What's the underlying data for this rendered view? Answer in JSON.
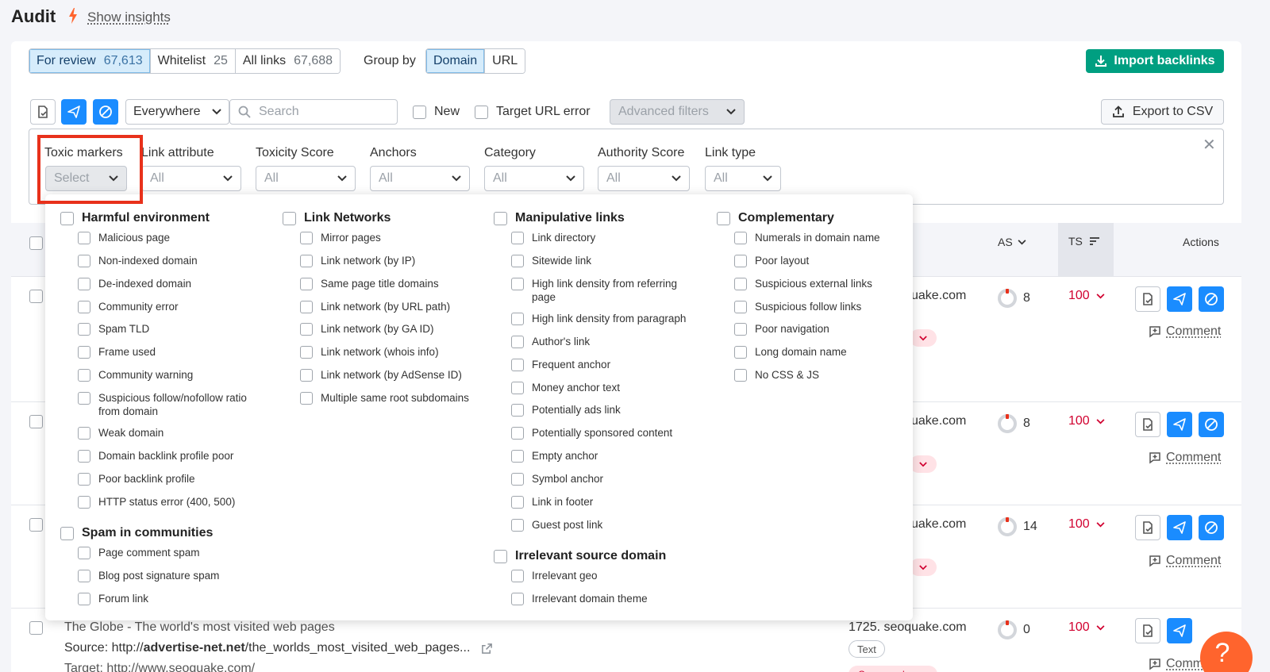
{
  "header": {
    "title": "Audit",
    "insights_label": "Show insights"
  },
  "tabs": [
    {
      "label": "For review",
      "count": "67,613",
      "active": true
    },
    {
      "label": "Whitelist",
      "count": "25",
      "active": false
    },
    {
      "label": "All links",
      "count": "67,688",
      "active": false
    }
  ],
  "group_by": {
    "label": "Group by",
    "options": [
      "Domain",
      "URL"
    ],
    "selected": "Domain"
  },
  "import_button": "Import backlinks",
  "toolbar": {
    "scope_dropdown": "Everywhere",
    "search_placeholder": "Search",
    "new_label": "New",
    "target_url_error_label": "Target URL error",
    "advanced_filters": "Advanced filters",
    "export": "Export to CSV"
  },
  "filters": [
    {
      "label": "Toxic markers",
      "value": "Select"
    },
    {
      "label": "Link attribute",
      "value": "All"
    },
    {
      "label": "Toxicity Score",
      "value": "All"
    },
    {
      "label": "Anchors",
      "value": "All"
    },
    {
      "label": "Category",
      "value": "All"
    },
    {
      "label": "Authority Score",
      "value": "All"
    },
    {
      "label": "Link type",
      "value": "All"
    }
  ],
  "table_header": {
    "as": "AS",
    "ts": "TS",
    "actions": "Actions"
  },
  "rows": [
    {
      "domain": "uake.com",
      "as": "8",
      "ts": "100",
      "comment": "Comment"
    },
    {
      "domain": "uake.com",
      "as": "8",
      "ts": "100",
      "comment": "Comment"
    },
    {
      "domain": "uake.com",
      "as": "14",
      "ts": "100",
      "comment": "Comment"
    }
  ],
  "bottom_row": {
    "title": "The Globe - The world's most visited web pages",
    "source_label": "Source: ",
    "source_prefix": "http://",
    "source_domain": "advertise-net.net",
    "source_path": "/the_worlds_most_visited_web_pages...",
    "target": "Target: http://www.seoquake.com/",
    "domain": "1725. seoquake.com",
    "link_type": "Text",
    "compound": "Compound",
    "as": "0",
    "ts": "100",
    "comment": "Comm"
  },
  "toxic_markers": {
    "harmful": {
      "title": "Harmful environment",
      "items": [
        "Malicious page",
        "Non-indexed domain",
        "De-indexed domain",
        "Community error",
        "Spam TLD",
        "Frame used",
        "Community warning",
        "Suspicious follow/nofollow ratio from domain",
        "Weak domain",
        "Domain backlink profile poor",
        "Poor backlink profile",
        "HTTP status error (400, 500)"
      ]
    },
    "spam": {
      "title": "Spam in communities",
      "items": [
        "Page comment spam",
        "Blog post signature spam",
        "Forum link"
      ]
    },
    "networks": {
      "title": "Link Networks",
      "items": [
        "Mirror pages",
        "Link network (by IP)",
        "Same page title domains",
        "Link network (by URL path)",
        "Link network (by GA ID)",
        "Link network (whois info)",
        "Link network (by AdSense ID)",
        "Multiple same root subdomains"
      ]
    },
    "manipulative": {
      "title": "Manipulative links",
      "items": [
        "Link directory",
        "Sitewide link",
        "High link density from referring page",
        "High link density from paragraph",
        "Author's link",
        "Frequent anchor",
        "Money anchor text",
        "Potentially ads link",
        "Potentially sponsored content",
        "Empty anchor",
        "Symbol anchor",
        "Link in footer",
        "Guest post link"
      ]
    },
    "irrelevant": {
      "title": "Irrelevant source domain",
      "items": [
        "Irrelevant geo",
        "Irrelevant domain theme"
      ]
    },
    "complementary": {
      "title": "Complementary",
      "items": [
        "Numerals in domain name",
        "Poor layout",
        "Suspicious external links",
        "Suspicious follow links",
        "Poor navigation",
        "Long domain name",
        "No CSS & JS"
      ]
    }
  },
  "help_icon": "?",
  "colors": {
    "accent": "#1a8cff",
    "import": "#009f81",
    "toxic": "#d1002f",
    "highlight": "#e8311b",
    "help": "#ff642d"
  }
}
